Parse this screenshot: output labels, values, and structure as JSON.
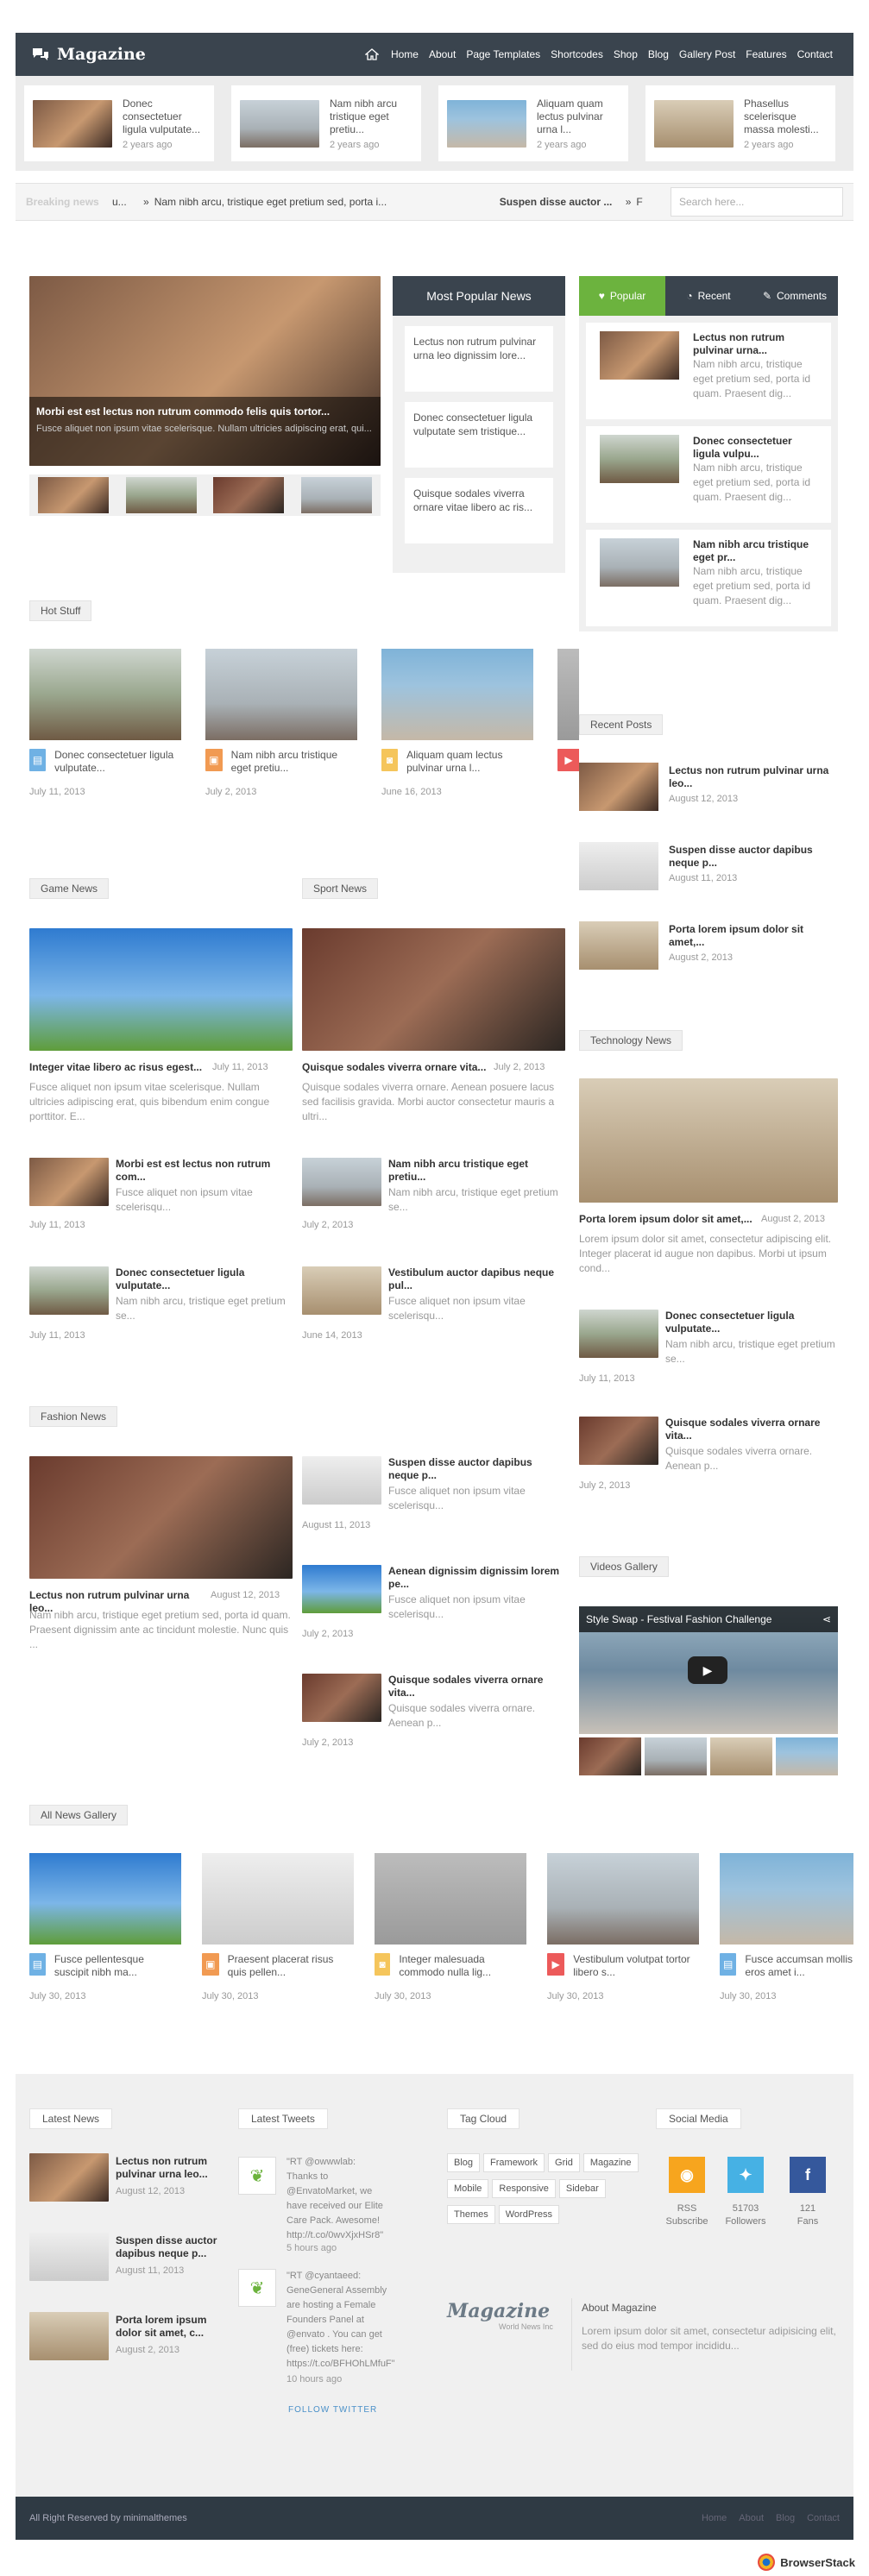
{
  "header": {
    "logo": "Magazine",
    "nav": [
      "Home",
      "About",
      "Page Templates",
      "Shortcodes",
      "Shop",
      "Blog",
      "Gallery Post",
      "Features",
      "Contact"
    ]
  },
  "top_cards": [
    {
      "title": "Donec consectetuer ligula vulputate...",
      "date": "2 years ago"
    },
    {
      "title": "Nam nibh arcu tristique eget pretiu...",
      "date": "2 years ago"
    },
    {
      "title": "Aliquam quam lectus pulvinar urna l...",
      "date": "2 years ago"
    },
    {
      "title": "Phasellus scelerisque massa molesti...",
      "date": "2 years ago"
    }
  ],
  "ticker": {
    "label": "Breaking news",
    "item1": "u...",
    "item2": "Nam nibh arcu, tristique eget pretium sed, porta i...",
    "item3": "Suspen disse auctor ...",
    "item4": "F",
    "search_placeholder": "Search here..."
  },
  "slider": {
    "title": "Morbi est est lectus non rutrum commodo felis quis tortor...",
    "text": "Fusce aliquet non ipsum vitae scelerisque. Nullam ultricies adipiscing erat, qui..."
  },
  "most_popular": {
    "heading": "Most Popular News",
    "items": [
      "Lectus non rutrum pulvinar urna leo dignissim lore...",
      "Donec consectetuer ligula vulputate sem tristique...",
      "Quisque sodales viverra ornare vitae libero ac ris..."
    ]
  },
  "tabs": {
    "popular": "Popular",
    "recent": "Recent",
    "comments": "Comments"
  },
  "tab_items": [
    {
      "title": "Lectus non rutrum pulvinar urna...",
      "text": "Nam nibh arcu, tristique eget pretium sed, porta id quam. Praesent dig..."
    },
    {
      "title": "Donec consectetuer ligula vulpu...",
      "text": "Nam nibh arcu, tristique eget pretium sed, porta id quam. Praesent dig..."
    },
    {
      "title": "Nam nibh arcu tristique eget pr...",
      "text": "Nam nibh arcu, tristique eget pretium sed, porta id quam. Praesent dig..."
    }
  ],
  "hot_stuff": {
    "label": "Hot Stuff",
    "items": [
      {
        "title": "Donec consectetuer ligula vulputate...",
        "date": "July 11, 2013"
      },
      {
        "title": "Nam nibh arcu tristique eget pretiu...",
        "date": "July 2, 2013"
      },
      {
        "title": "Aliquam quam lectus pulvinar urna l...",
        "date": "June 16, 2013"
      }
    ]
  },
  "recent_posts": {
    "label": "Recent Posts",
    "items": [
      {
        "title": "Lectus non rutrum pulvinar urna leo...",
        "date": "August 12, 2013"
      },
      {
        "title": "Suspen disse auctor dapibus neque p...",
        "date": "August 11, 2013"
      },
      {
        "title": "Porta lorem ipsum dolor sit amet,...",
        "date": "August 2, 2013"
      }
    ]
  },
  "game_news": {
    "label": "Game News",
    "main_title": "Integer vitae libero ac risus egest...",
    "main_date": "July 11, 2013",
    "main_text": "Fusce aliquet non ipsum vitae scelerisque. Nullam ultricies adipiscing erat, quis bibendum enim congue porttitor. E...",
    "items": [
      {
        "title": "Morbi est est lectus non rutrum com...",
        "text": "Fusce aliquet non ipsum vitae scelerisqu...",
        "date": "July 11, 2013"
      },
      {
        "title": "Donec consectetuer ligula vulputate...",
        "text": "Nam nibh arcu, tristique eget pretium se...",
        "date": "July 11, 2013"
      }
    ]
  },
  "sport_news": {
    "label": "Sport News",
    "main_title": "Quisque sodales viverra ornare vita...",
    "main_date": "July 2, 2013",
    "main_text": "Quisque sodales viverra ornare. Aenean posuere lacus sed facilisis gravida. Morbi auctor consectetur mauris a ultri...",
    "items": [
      {
        "title": "Nam nibh arcu tristique eget pretiu...",
        "text": "Nam nibh arcu, tristique eget pretium se...",
        "date": "July 2, 2013"
      },
      {
        "title": "Vestibulum auctor dapibus neque pul...",
        "text": "Fusce aliquet non ipsum vitae scelerisqu...",
        "date": "June 14, 2013"
      }
    ]
  },
  "tech_news": {
    "label": "Technology News",
    "main_title": "Porta lorem ipsum dolor sit amet,...",
    "main_date": "August 2, 2013",
    "main_text": "Lorem ipsum dolor sit amet, consectetur adipiscing elit. Integer placerat id augue non dapibus. Morbi ut ipsum cond...",
    "items": [
      {
        "title": "Donec consectetuer ligula vulputate...",
        "text": "Nam nibh arcu, tristique eget pretium se...",
        "date": "July 11, 2013"
      },
      {
        "title": "Quisque sodales viverra ornare vita...",
        "text": "Quisque sodales viverra ornare. Aenean p...",
        "date": "July 2, 2013"
      }
    ]
  },
  "fashion_news": {
    "label": "Fashion News",
    "main_title": "Lectus non rutrum pulvinar urna leo...",
    "main_date": "August 12, 2013",
    "main_text": "Nam nibh arcu, tristique eget pretium sed, porta id quam. Praesent dignissim ante ac tincidunt molestie. Nunc quis ...",
    "items": [
      {
        "title": "Suspen disse auctor dapibus neque p...",
        "text": "Fusce aliquet non ipsum vitae scelerisqu...",
        "date": "August 11, 2013"
      },
      {
        "title": "Aenean dignissim dignissim lorem pe...",
        "text": "Fusce aliquet non ipsum vitae scelerisqu...",
        "date": "July 2, 2013"
      },
      {
        "title": "Quisque sodales viverra ornare vita...",
        "text": "Quisque sodales viverra ornare. Aenean p...",
        "date": "July 2, 2013"
      }
    ]
  },
  "videos": {
    "label": "Videos Gallery",
    "video_title": "Style Swap - Festival Fashion Challenge"
  },
  "gallery": {
    "label": "All News Gallery",
    "items": [
      {
        "title": "Fusce pellentesque suscipit nibh ma...",
        "date": "July 30, 2013"
      },
      {
        "title": "Praesent placerat risus quis pellen...",
        "date": "July 30, 2013"
      },
      {
        "title": "Integer malesuada commodo nulla lig...",
        "date": "July 30, 2013"
      },
      {
        "title": "Vestibulum volutpat tortor libero s...",
        "date": "July 30, 2013"
      },
      {
        "title": "Fusce accumsan mollis eros amet i...",
        "date": "July 30, 2013"
      }
    ]
  },
  "footer": {
    "latest_news": {
      "label": "Latest News",
      "items": [
        {
          "title": "Lectus non rutrum pulvinar urna leo...",
          "date": "August 12, 2013"
        },
        {
          "title": "Suspen disse auctor dapibus neque p...",
          "date": "August 11, 2013"
        },
        {
          "title": "Porta lorem ipsum dolor sit amet, c...",
          "date": "August 2, 2013"
        }
      ]
    },
    "tweets": {
      "label": "Latest Tweets",
      "t1": "\"RT @owwwlab: Thanks to @EnvatoMarket, we have received our Elite Care Pack. Awesome! http://t.co/0wvXjxHSr8\"",
      "t1_time": "5 hours ago",
      "t2": "\"RT @cyantaeed: GeneGeneral Assembly are hosting a Female Founders Panel at @envato . You can get (free) tickets here: https://t.co/BFHOhLMfuF\"",
      "t2_time": "10 hours ago",
      "follow": "FOLLOW TWITTER"
    },
    "tags": {
      "label": "Tag Cloud",
      "items": [
        "Blog",
        "Framework",
        "Grid",
        "Magazine",
        "Mobile",
        "Responsive",
        "Sidebar",
        "Themes",
        "WordPress"
      ]
    },
    "social": {
      "label": "Social Media",
      "rss": "RSS",
      "rss_sub": "Subscribe",
      "tw": "51703",
      "tw_sub": "Followers",
      "fb": "121",
      "fb_sub": "Fans"
    },
    "about": {
      "logo": "Magazine",
      "logo_sub": "World News Inc",
      "title": "About Magazine",
      "text": "Lorem ipsum dolor sit amet, consectetur adipisicing elit, sed do eius mod tempor incididu..."
    }
  },
  "bottom": {
    "copyright": "All Right Reserved by minimalthemes",
    "links": [
      "Home",
      "About",
      "Blog",
      "Contact"
    ]
  },
  "browserstack": "BrowserStack",
  "colors": {
    "dark": "#3a444e",
    "green": "#6cb33e",
    "blue": "#4a90c8"
  }
}
